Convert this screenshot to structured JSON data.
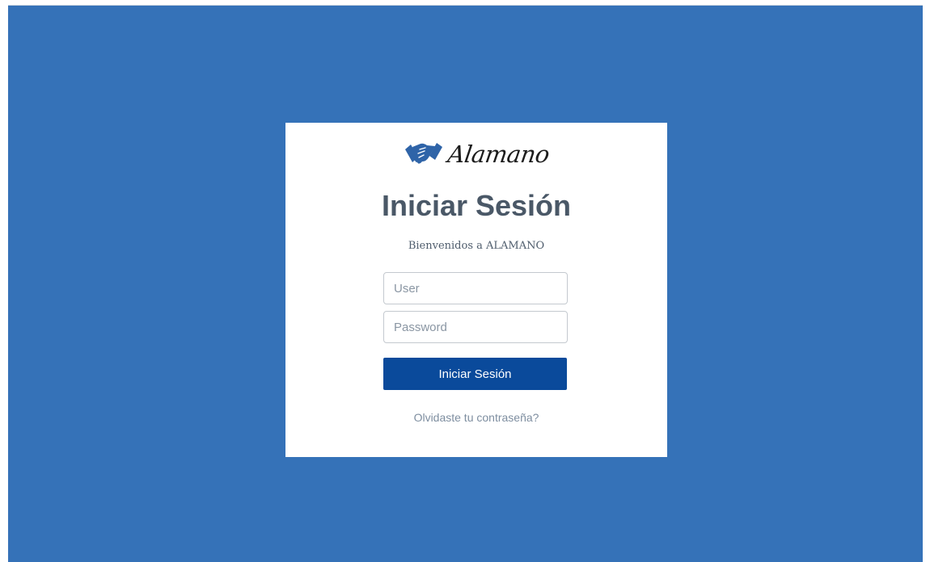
{
  "brand": {
    "name": "Alamano",
    "logo_icon": "handshake-icon",
    "logo_color": "#2f64a8"
  },
  "login": {
    "title": "Iniciar Sesión",
    "subtitle": "Bienvenidos a ALAMANO",
    "user_placeholder": "User",
    "user_value": "",
    "password_placeholder": "Password",
    "password_value": "",
    "submit_label": "Iniciar Sesión",
    "forgot_label": "Olvidaste tu contraseña?"
  },
  "colors": {
    "background": "#3572b8",
    "card": "#ffffff",
    "primary_button": "#0a4a9b",
    "title_text": "#4a5867"
  }
}
